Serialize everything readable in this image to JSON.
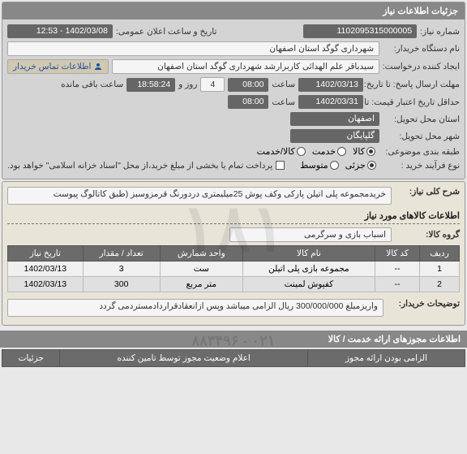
{
  "header": {
    "title": "جزئیات اطلاعات نیاز"
  },
  "info": {
    "labels": {
      "need_no": "شماره نیاز:",
      "public_datetime": "تاریخ و ساعت اعلان عمومی:",
      "buyer_org": "نام دستگاه خریدار:",
      "requester": "ایجاد کننده درخواست:",
      "contact": "اطلاعات تماس خریدار",
      "deadline": "مهلت ارسال پاسخ: تا تاریخ:",
      "time": "ساعت",
      "and": "و",
      "day": "روز و",
      "remain": "ساعت باقی مانده",
      "valid_from": "حداقل تاریخ اعتبار قیمت: تا تاریخ:",
      "need_city": "استان محل تحویل:",
      "delivery_city": "شهر محل تحویل:",
      "classify": "طبقه بندی موضوعی:",
      "process_type": "نوع فرآیند خرید :",
      "payment_note": "پرداخت تمام یا بخشی از مبلغ خرید،از محل \"اسناد خزانه اسلامی\" خواهد بود."
    },
    "values": {
      "need_no": "1102095315000005",
      "public_datetime": "1402/03/08 - 12:53",
      "buyer_org": "شهرداری گوگد استان اصفهان",
      "requester": "سیدباقر علم الهدائی کاربرارشد شهرداری گوگد استان اصفهان",
      "deadline_date": "1402/03/13",
      "deadline_time": "08:00",
      "remain_days": "4",
      "remain_time": "18:58:24",
      "valid_date": "1402/03/31",
      "valid_time": "08:00",
      "need_city": "اصفهان",
      "delivery_city": "گلپایگان"
    },
    "classify_options": [
      "کالا",
      "خدمت",
      "کالا/خدمت"
    ],
    "classify_selected": "کالا",
    "process_options": [
      "جزئی",
      "متوسط"
    ],
    "process_selected": "جزئی"
  },
  "detail": {
    "labels": {
      "desc": "شرح کلی نیاز:",
      "items_header": "اطلاعات کالاهای مورد نیاز",
      "group": "گروه کالا:",
      "notes": "توضیحات خریدار:"
    },
    "desc": "خریدمجموعه پلی اتیلن پارکی وکف پوش 25میلیمتری دردورنگ قرمزوسبز (طبق کاتالوگ پیوست",
    "group": "اسباب بازی و سرگرمی",
    "table": {
      "cols": [
        "ردیف",
        "کد کالا",
        "نام کالا",
        "واحد شمارش",
        "تعداد / مقدار",
        "تاریخ نیاز"
      ],
      "rows": [
        [
          "1",
          "--",
          "مجموعه بازی پلی اتیلن",
          "ست",
          "3",
          "1402/03/13"
        ],
        [
          "2",
          "--",
          "کفپوش لمینت",
          "متر مربع",
          "300",
          "1402/03/13"
        ]
      ]
    },
    "notes": "واریزمبلغ 300/000/000 ریال الزامی میباشد وپس ازانعقادقراردادمستردمی گردد"
  },
  "footer": {
    "title": "اطلاعات مجوزهای ارائه خدمت / کالا",
    "cols": [
      "الزامی بودن ارائه مجوز",
      "اعلام وضعیت مجوز توسط تامین کننده",
      "جزئیات"
    ]
  },
  "phone_overlay": "۰۲۱ - ۸۸۳۴۹۶"
}
